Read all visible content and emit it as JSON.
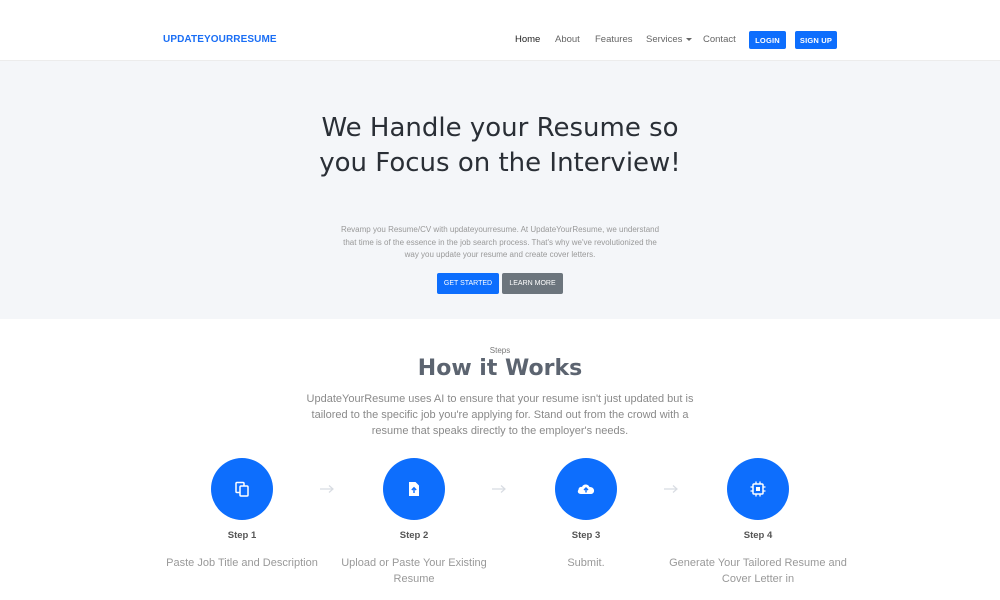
{
  "brand": "UPDATEYOURRESUME",
  "nav": {
    "home": "Home",
    "about": "About",
    "features": "Features",
    "services": "Services",
    "contact": "Contact",
    "login": "LOGIN",
    "signup": "SIGN UP"
  },
  "hero": {
    "title": "We Handle your Resume so you Focus on the Interview!",
    "subtitle": "Revamp you Resume/CV with updateyourresume. At UpdateYourResume, we understand that time is of the essence in the job search process. That's why we've revolutionized the way you update your resume and create cover letters.",
    "primary_button": "GET STARTED",
    "secondary_button": "LEARN MORE"
  },
  "how": {
    "eyebrow": "Steps",
    "title": "How it Works",
    "description": "UpdateYourResume uses AI to ensure that your resume isn't just updated but is tailored to the specific job you're applying for. Stand out from the crowd with a resume that speaks directly to the employer's needs."
  },
  "steps": [
    {
      "label": "Step 1",
      "text": "Paste Job Title and Description",
      "icon": "copy-icon"
    },
    {
      "label": "Step 2",
      "text": "Upload or Paste Your Existing Resume",
      "icon": "file-upload-icon"
    },
    {
      "label": "Step 3",
      "text": "Submit.",
      "icon": "cloud-upload-icon"
    },
    {
      "label": "Step 4",
      "text": "Generate Your Tailored Resume and Cover Letter in",
      "icon": "cpu-icon"
    }
  ],
  "colors": {
    "accent": "#0d6efd",
    "brand": "#1a6ef5",
    "hero_bg": "#f4f6f9",
    "secondary": "#6c757d"
  }
}
